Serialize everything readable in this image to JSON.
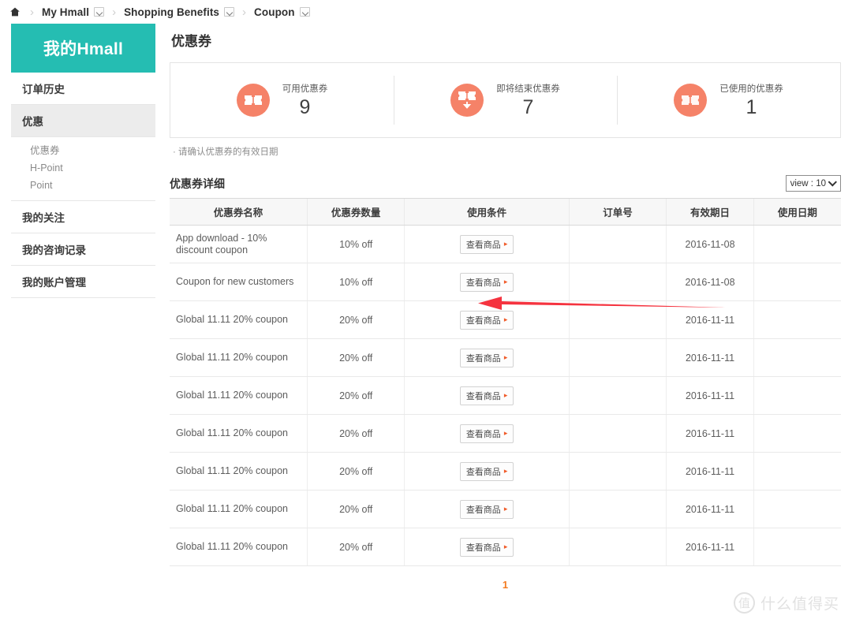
{
  "breadcrumb": {
    "home_icon": "home-icon",
    "separator": "›",
    "items": [
      {
        "label": "My Hmall",
        "has_dropdown": true
      },
      {
        "label": "Shopping Benefits",
        "has_dropdown": true
      },
      {
        "label": "Coupon",
        "has_dropdown": true
      }
    ]
  },
  "sidebar": {
    "title": "我的Hmall",
    "items": [
      {
        "label": "订单历史",
        "active": false
      },
      {
        "label": "优惠",
        "active": true
      }
    ],
    "sub_items": [
      {
        "label": "优惠券"
      },
      {
        "label": "H-Point"
      },
      {
        "label": "Point"
      }
    ],
    "items_after": [
      {
        "label": "我的关注"
      },
      {
        "label": "我的咨询记录"
      },
      {
        "label": "我的账户管理"
      }
    ]
  },
  "main": {
    "page_title": "优惠券",
    "summary": [
      {
        "icon": "coupon-ticket-icon",
        "label": "可用优惠券",
        "value": "9"
      },
      {
        "icon": "coupon-expiring-icon",
        "label": "即将结束优惠券",
        "value": "7"
      },
      {
        "icon": "coupon-used-icon",
        "label": "已使用的优惠券",
        "value": "1"
      }
    ],
    "notice": "· 请确认优惠券的有效日期",
    "table_title": "优惠券详细",
    "view_select": {
      "label": "view : 10",
      "icon": "chevron-down-icon"
    },
    "columns": [
      "优惠券名称",
      "优惠券数量",
      "使用条件",
      "订单号",
      "有效期日",
      "使用日期"
    ],
    "row_button_label": "查看商品",
    "row_button_arrow": "▸",
    "rows": [
      {
        "name": "App download - 10% discount coupon",
        "amount": "10% off",
        "order_no": "",
        "valid_date": "2016-11-08",
        "used_date": ""
      },
      {
        "name": "Coupon for new customers",
        "amount": "10% off",
        "order_no": "",
        "valid_date": "2016-11-08",
        "used_date": ""
      },
      {
        "name": "Global 11.11 20% coupon",
        "amount": "20% off",
        "order_no": "",
        "valid_date": "2016-11-11",
        "used_date": ""
      },
      {
        "name": "Global 11.11 20% coupon",
        "amount": "20% off",
        "order_no": "",
        "valid_date": "2016-11-11",
        "used_date": ""
      },
      {
        "name": "Global 11.11 20% coupon",
        "amount": "20% off",
        "order_no": "",
        "valid_date": "2016-11-11",
        "used_date": ""
      },
      {
        "name": "Global 11.11 20% coupon",
        "amount": "20% off",
        "order_no": "",
        "valid_date": "2016-11-11",
        "used_date": ""
      },
      {
        "name": "Global 11.11 20% coupon",
        "amount": "20% off",
        "order_no": "",
        "valid_date": "2016-11-11",
        "used_date": ""
      },
      {
        "name": "Global 11.11 20% coupon",
        "amount": "20% off",
        "order_no": "",
        "valid_date": "2016-11-11",
        "used_date": ""
      },
      {
        "name": "Global 11.11 20% coupon",
        "amount": "20% off",
        "order_no": "",
        "valid_date": "2016-11-11",
        "used_date": ""
      }
    ],
    "pagination": {
      "current": "1"
    }
  },
  "annotations": {
    "arrow": {
      "name": "red-pointer-arrow",
      "color": "#f5333f",
      "direction": "left"
    }
  },
  "watermark": {
    "mark": "值",
    "text": "什么值得买"
  },
  "colors": {
    "brand_teal": "#25bdb2",
    "accent_orange": "#f58268",
    "pager_orange": "#f47b20",
    "arrow_red": "#f5333f"
  }
}
